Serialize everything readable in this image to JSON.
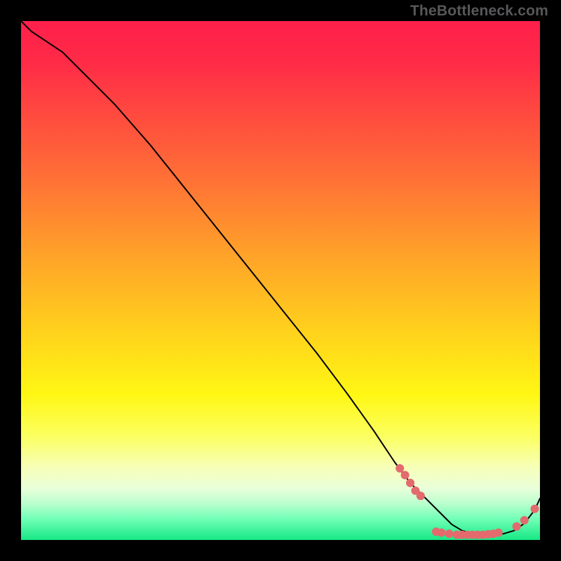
{
  "watermark": "TheBottleneck.com",
  "colors": {
    "background": "#000000",
    "curve": "#000000",
    "dot": "#e36a6d",
    "gradient_top": "#ff1f4b",
    "gradient_bottom": "#17e884"
  },
  "chart_data": {
    "type": "line",
    "title": "",
    "xlabel": "",
    "ylabel": "",
    "xlim": [
      0,
      100
    ],
    "ylim": [
      0,
      100
    ],
    "grid": false,
    "legend": null,
    "series": [
      {
        "name": "curve",
        "x": [
          0,
          2,
          5,
          8,
          12,
          18,
          25,
          33,
          41,
          49,
          57,
          63,
          68,
          72,
          75,
          78,
          81,
          83,
          85,
          87,
          89,
          91,
          93,
          95,
          97,
          99,
          100
        ],
        "y": [
          100,
          98,
          96,
          94,
          90,
          84,
          76,
          66,
          56,
          46,
          36,
          28,
          21,
          15,
          11,
          8,
          5,
          3,
          1.8,
          1.2,
          1.0,
          1.0,
          1.2,
          1.8,
          3.2,
          5.8,
          8.0
        ]
      }
    ],
    "markers": [
      {
        "x": 73,
        "y": 13.8
      },
      {
        "x": 74,
        "y": 12.5
      },
      {
        "x": 75,
        "y": 11.0
      },
      {
        "x": 76,
        "y": 9.5
      },
      {
        "x": 77,
        "y": 8.5
      },
      {
        "x": 80,
        "y": 1.6
      },
      {
        "x": 81,
        "y": 1.4
      },
      {
        "x": 82.5,
        "y": 1.2
      },
      {
        "x": 84,
        "y": 1.0
      },
      {
        "x": 85,
        "y": 1.0
      },
      {
        "x": 86,
        "y": 1.0
      },
      {
        "x": 87,
        "y": 1.0
      },
      {
        "x": 88,
        "y": 1.0
      },
      {
        "x": 89,
        "y": 1.0
      },
      {
        "x": 90,
        "y": 1.1
      },
      {
        "x": 91,
        "y": 1.2
      },
      {
        "x": 92,
        "y": 1.4
      },
      {
        "x": 95.5,
        "y": 2.6
      },
      {
        "x": 97,
        "y": 3.8
      },
      {
        "x": 99,
        "y": 6.0
      }
    ]
  }
}
